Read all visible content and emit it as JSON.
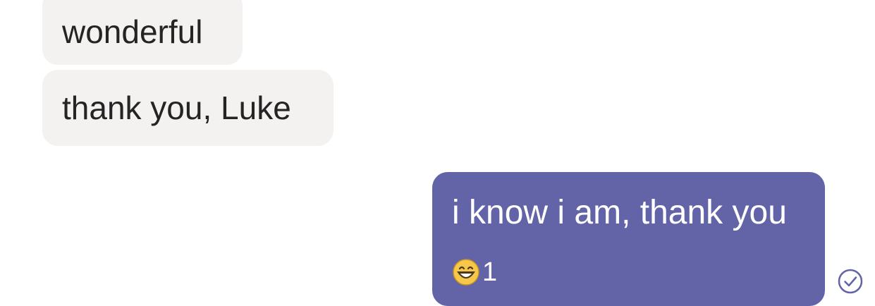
{
  "messages": {
    "incoming": [
      {
        "text": "wonderful"
      },
      {
        "text": "thank you, Luke"
      }
    ],
    "outgoing": {
      "text": "i know i am, thank you",
      "reaction": {
        "emoji_name": "grinning-face-icon",
        "count": "1"
      }
    }
  },
  "colors": {
    "incoming_bubble": "#f3f2f1",
    "outgoing_bubble": "#6264a7",
    "incoming_text": "#242424",
    "outgoing_text": "#ffffff",
    "emoji_face": "#f5c84c",
    "receipt": "#6264a7"
  }
}
